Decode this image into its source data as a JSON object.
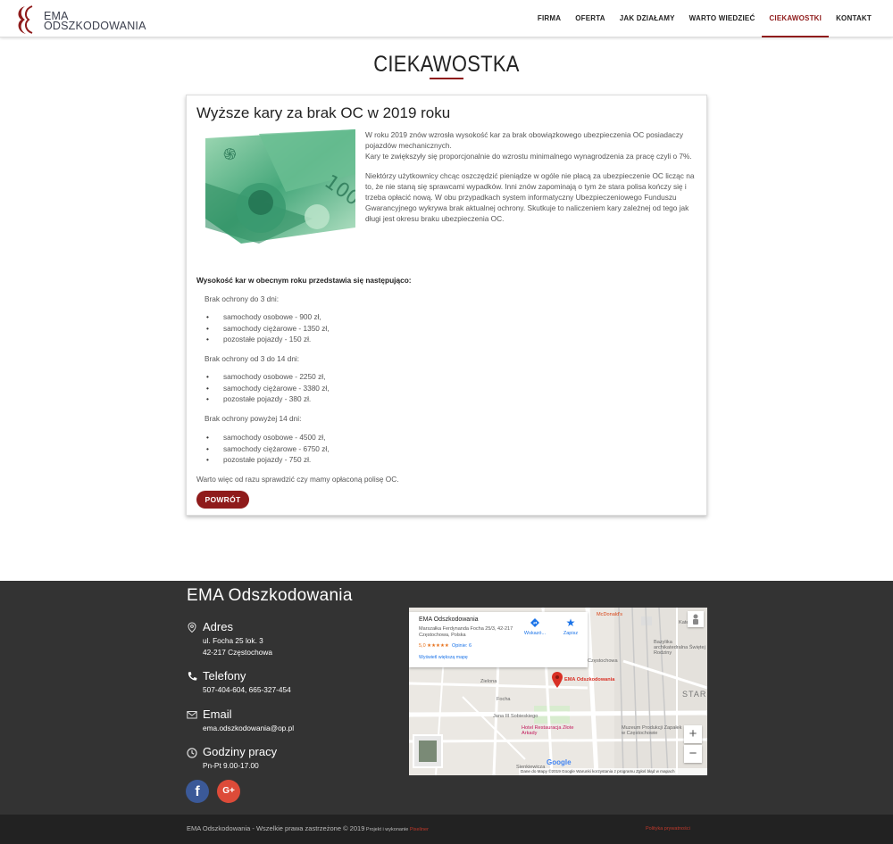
{
  "nav": {
    "logo_line1": "EMA",
    "logo_line2": "ODSZKODOWANIA",
    "items": [
      {
        "label": "FIRMA"
      },
      {
        "label": "OFERTA"
      },
      {
        "label": "JAK DZIAŁAMY"
      },
      {
        "label": "WARTO WIEDZIEĆ"
      },
      {
        "label": "CIEKAWOSTKI",
        "active": true
      },
      {
        "label": "KONTAKT"
      }
    ]
  },
  "page": {
    "title": "CIEKAWOSTKA"
  },
  "article": {
    "title": "Wyższe kary za brak OC w 2019 roku",
    "image_alt": "banknotes-100-pln",
    "paragraph1a": "W roku 2019 znów wzrosła wysokość kar za brak obowiązkowego ubezpieczenia OC posiadaczy pojazdów mechanicznych.",
    "paragraph1b": "Kary te zwiększyły się proporcjonalnie do wzrostu minimalnego wynagrodzenia za pracę czyli o 7%.",
    "paragraph2": "Niektórzy użytkownicy chcąc oszczędzić pieniądze w ogóle nie płacą za ubezpieczenie OC licząc na to, że nie staną się sprawcami wypadków. Inni znów zapominają o tym że stara polisa kończy się i trzeba opłacić nową. W obu przypadkach system informatyczny Ubezpieczeniowego Funduszu Gwarancyjnego wykrywa brak aktualnej ochrony. Skutkuje to naliczeniem kary zależnej od tego jak długi jest okresu braku ubezpieczenia OC.",
    "section_head": "Wysokość kar w obecnym roku przedstawia się następująco:",
    "periods": [
      {
        "label": "Brak ochrony do 3 dni:",
        "items": [
          "samochody osobowe - 900 zł,",
          "samochody ciężarowe - 1350 zł,",
          "pozostałe pojazdy - 150 zł."
        ]
      },
      {
        "label": "Brak ochrony od 3 do 14 dni:",
        "items": [
          "samochody osobowe - 2250 zł,",
          "samochody ciężarowe - 3380 zł,",
          "pozostałe pojazdy - 380 zł."
        ]
      },
      {
        "label": "Brak ochrony powyżej 14 dni:",
        "items": [
          "samochody osobowe - 4500 zł,",
          "samochody ciężarowe - 6750 zł,",
          "pozostałe pojazdy - 750 zł."
        ]
      }
    ],
    "closing": "Warto więc od razu sprawdzić czy mamy opłaconą polisę OC.",
    "back_label": "POWRÓT"
  },
  "footer": {
    "brand": "EMA Odszkodowania",
    "address_head": "Adres",
    "address_line1": "ul. Focha 25 lok. 3",
    "address_line2": "42-217 Częstochowa",
    "phones_head": "Telefony",
    "phones_value": "507-404-604, 665-327-454",
    "email_head": "Email",
    "email_value": "ema.odszkodowania@op.pl",
    "hours_head": "Godziny pracy",
    "hours_value": "Pn-Pt 9.00-17.00",
    "facebook_label": "f",
    "google_label": "G+"
  },
  "map": {
    "place_name": "EMA Odszkodowania",
    "place_address": "Marszałka Ferdynanda Focha 25/3, 42-217 Częstochowa, Polska",
    "rating": "5,0 ★★★★★",
    "reviews": "Opinie: 6",
    "larger_map": "Wyświetl większą mapę",
    "directions": "Wskazó...",
    "save": "Zapisz",
    "pin_label": "EMA Odszkodowania",
    "labels": {
      "czestochowa": "Częstochowa",
      "jana": "Jana III Sobieskiego",
      "hotel": "Hotel Restauracja Złote Arkady",
      "museum": "Muzeum Produkcji Zapałek w Częstochowie",
      "bazylika": "Bazylika archikatedralna Świętej Rodziny",
      "star": "STAR",
      "focha": "Focha",
      "katedralna": "Katedralna",
      "mcd": "McDonald's",
      "zielona": "Zielona",
      "sienkiewicza": "Sienkiewicza"
    },
    "attribution": "Dane do Mapy ©2019 Google    Warunki korzystania z programu    Zgłoś błąd w mapach",
    "google_logo": "Google"
  },
  "bottom": {
    "copyright": "EMA Odszkodowania - Wszelkie prawa zastrzeżone © 2019",
    "credit_prefix": " Projekt i wykonanie ",
    "credit": "Pixeliner",
    "privacy": "Polityka prywatności"
  },
  "colors": {
    "accent": "#8f1b1b",
    "footer": "#333333",
    "bottom": "#222222"
  }
}
